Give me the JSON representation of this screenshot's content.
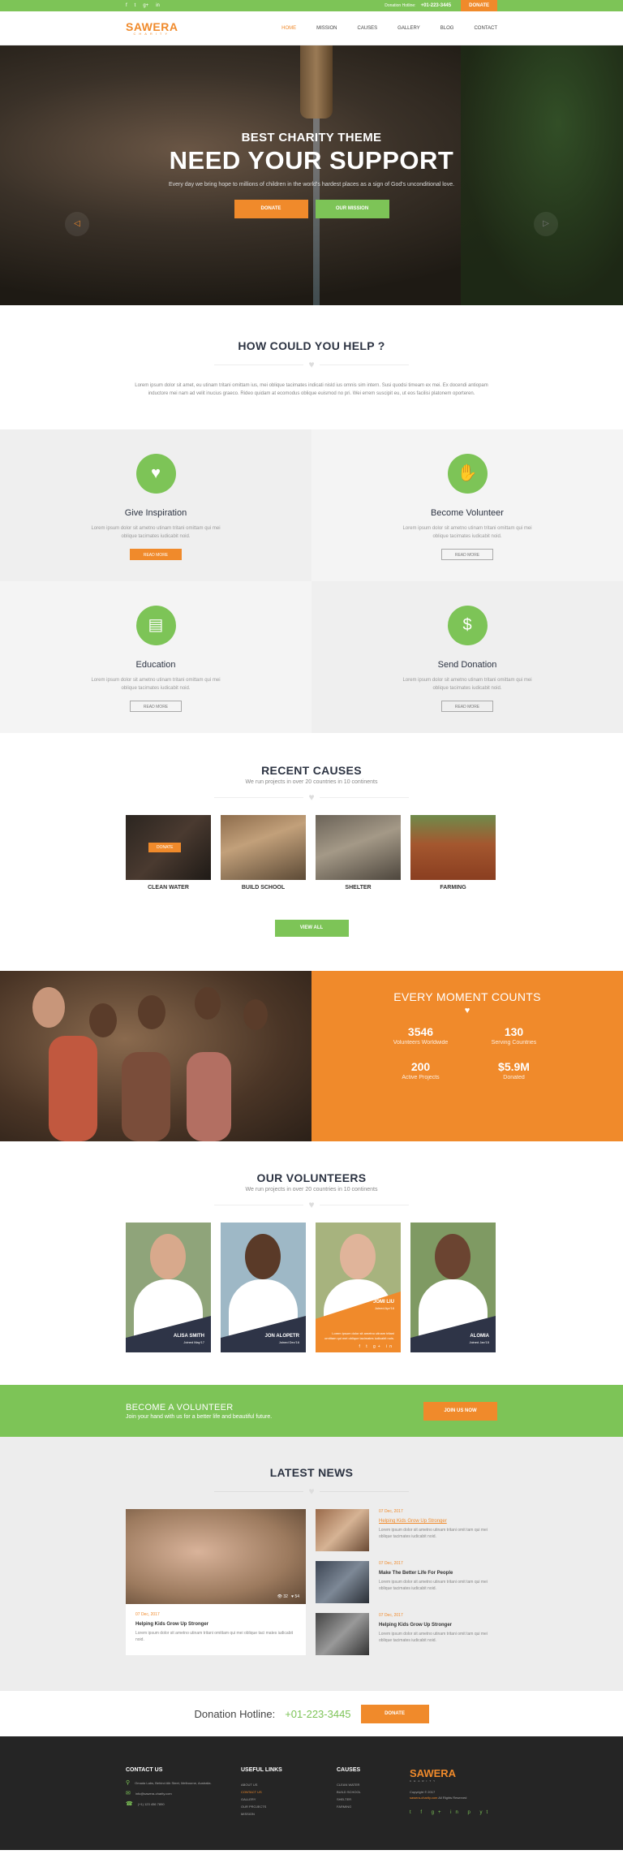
{
  "topbar": {
    "social": [
      "f",
      "t",
      "g+",
      "in"
    ],
    "hotline_label": "Donation Hotline:",
    "hotline_number": "+01-223-3445",
    "donate_label": "DONATE"
  },
  "logo": {
    "name": "SAWERA",
    "tagline": "CHARITY"
  },
  "menu": [
    "HOME",
    "MISSION",
    "CAUSES",
    "GALLERY",
    "BLOG",
    "CONTACT"
  ],
  "hero": {
    "kicker": "BEST CHARITY THEME",
    "title": "NEED YOUR SUPPORT",
    "text": "Every day we bring hope to millions of children in the world's hardest places as a sign of God's unconditional love.",
    "btn_donate": "DONATE",
    "btn_mission": "OUR MISSION"
  },
  "help": {
    "title": "HOW COULD YOU HELP ?",
    "text": "Lorem ipsum dolor sit amet, eu utinam tritani omittam ius, mei oblique tacimates indicati nisld ius omnis sim intern. Susi quodsi timeam ex mei. Ex docendi antiopam inductore mei nam ad velit inucius graeco. Rideo quidam at ecomodus oblique euismod no pri. Wei errem suscipit eu, ut eos facilisi platonem oporteren."
  },
  "features": [
    {
      "title": "Give Inspiration",
      "text": "Lorem ipsum dolor sit ametno utinam tritani omittam qui mei oblique tacimates iudicabit noid.",
      "btn": "READ MORE",
      "icon": "♥"
    },
    {
      "title": "Become Volunteer",
      "text": "Lorem ipsum dolor sit ametno utinam tritani omittam qui mei oblique tacimates iudicabit noid.",
      "btn": "READ MORE",
      "icon": "✋"
    },
    {
      "title": "Education",
      "text": "Lorem ipsum dolor sit ametno utinam tritani omittam qui mei oblique tacimates iudicabit noid.",
      "btn": "READ MORE",
      "icon": "▤"
    },
    {
      "title": "Send Donation",
      "text": "Lorem ipsum dolor sit ametno utinam tritani omittam qui mei oblique tacimates iudicabit noid.",
      "btn": "READ MORE",
      "icon": "$"
    }
  ],
  "causes": {
    "title": "RECENT CAUSES",
    "subtitle": "We run projects in over 20 countries in 10 continents",
    "items": [
      "CLEAN WATER",
      "BUILD SCHOOL",
      "SHELTER",
      "FARMING"
    ],
    "donate_tag": "DONATE",
    "view_all": "VIEW ALL"
  },
  "moment": {
    "title": "EVERY MOMENT COUNTS",
    "stats": [
      {
        "value": "3546",
        "label": "Volunteers Worldwide"
      },
      {
        "value": "130",
        "label": "Serving Countries"
      },
      {
        "value": "200",
        "label": "Active Projects"
      },
      {
        "value": "$5.9M",
        "label": "Donated"
      }
    ]
  },
  "volunteers": {
    "title": "OUR VOLUNTEERS",
    "subtitle": "We run projects in over 20 countries in 10 continents",
    "people": [
      {
        "name": "ALISA SMITH",
        "joined": "Joined May'17"
      },
      {
        "name": "JON ALOPETR",
        "joined": "Joined Dec'16"
      },
      {
        "name": "JOMI LIU",
        "joined": "Joined Apr'16",
        "desc": "Lorem ipsum dolor sit ametno utinam tritani omittam qui mei oblique tacimates iudicabit nois."
      },
      {
        "name": "ALOMIA",
        "joined": "Joined Jan'15"
      }
    ]
  },
  "become": {
    "title": "BECOME A VOLUNTEER",
    "text": "Join your hand with us for a better life and beautiful future.",
    "btn": "JOIN US NOW"
  },
  "news": {
    "title": "LATEST  NEWS",
    "featured": {
      "date": "07 Dec, 2017",
      "title": "Helping Kids Grow Up Stronger",
      "excerpt": "Lorem ipsum dolor sit ametno utinam tritani omittam qui mei oblique taci mates iudicabit noid.",
      "views": "32",
      "likes": "54"
    },
    "items": [
      {
        "date": "07 Dec, 2017",
        "title": "Helping Kids Grow Up Stronger",
        "excerpt": "Lorem ipsum dolor sit ametno utinam tritani omit tam qui mei oblique tacimates iudicabit noid."
      },
      {
        "date": "07 Dec, 2017",
        "title": "Make The Better Life For People",
        "excerpt": "Lorem ipsum dolor sit ametno utinam tritani omit tam qui mei oblique tacimates iudicabit noid."
      },
      {
        "date": "07 Dec, 2017",
        "title": "Helping Kids Grow Up Stronger",
        "excerpt": "Lorem ipsum dolor sit ametno utinam tritani omit tam qui mei oblique tacimates iudicabit noid."
      }
    ]
  },
  "hotline": {
    "label": "Donation Hotline:",
    "number": "+01-223-3445",
    "btn": "DONATE"
  },
  "footer": {
    "contact_title": "CONTACT US",
    "address": "Omada Labs, Behind Alb Steet, Melbourne, Australia.",
    "email": "info@sawera-charity.com",
    "phone": "(+1) 123 456 7890",
    "links_title": "USEFUL LINKS",
    "links": [
      "ABOUT US",
      "CONTACT US",
      "GALLERY",
      "OUR PROJECTS",
      "MISSION"
    ],
    "causes_title": "CAUSES",
    "causes": [
      "CLEAN WATER",
      "BUILD SCHOOL",
      "SHELTER",
      "FARMING"
    ],
    "copyright": "Copyright © 2017",
    "site": "sawera-charity.com",
    "rights": "All Rights Reserved"
  }
}
